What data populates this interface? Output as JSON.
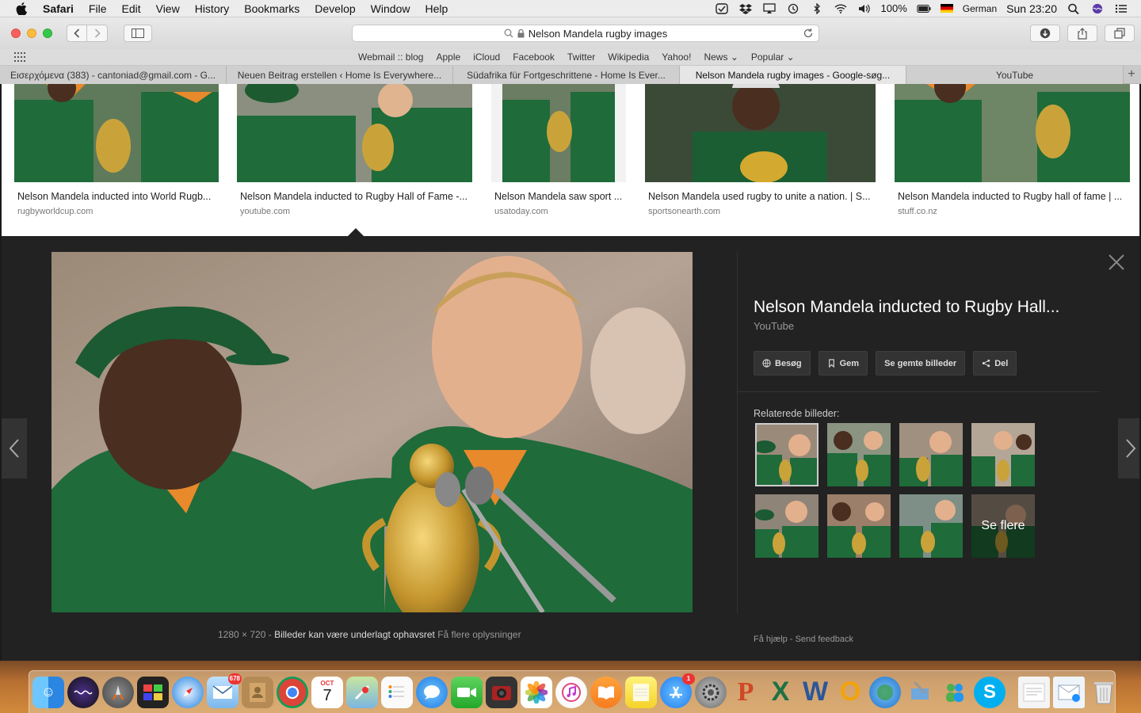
{
  "menubar": {
    "app_name": "Safari",
    "items": [
      "File",
      "Edit",
      "View",
      "History",
      "Bookmarks",
      "Develop",
      "Window",
      "Help"
    ],
    "battery": "100%",
    "input_source": "German",
    "clock": "Sun 23:20"
  },
  "toolbar": {
    "url": "Nelson Mandela rugby images"
  },
  "favorites": [
    "Webmail :: blog",
    "Apple",
    "iCloud",
    "Facebook",
    "Twitter",
    "Wikipedia",
    "Yahoo!",
    "News",
    "Popular"
  ],
  "tabs": [
    {
      "label": "Εισερχόμενα (383) - cantoniad@gmail.com - G...",
      "active": false
    },
    {
      "label": "Neuen Beitrag erstellen ‹ Home Is Everywhere...",
      "active": false
    },
    {
      "label": "Südafrika für Fortgeschrittene - Home Is Ever...",
      "active": false
    },
    {
      "label": "Nelson Mandela rugby images - Google-søg...",
      "active": true
    },
    {
      "label": "YouTube",
      "active": false
    }
  ],
  "results": [
    {
      "title": "Nelson Mandela inducted into World Rugb...",
      "source": "rugbyworldcup.com"
    },
    {
      "title": "Nelson Mandela inducted to Rugby Hall of Fame -...",
      "source": "youtube.com"
    },
    {
      "title": "Nelson Mandela saw sport ...",
      "source": "usatoday.com"
    },
    {
      "title": "Nelson Mandela used rugby to unite a nation. | S...",
      "source": "sportsonearth.com"
    },
    {
      "title": "Nelson Mandela inducted to Rugby hall of fame | ...",
      "source": "stuff.co.nz"
    }
  ],
  "viewer": {
    "title": "Nelson Mandela inducted to Rugby Hall...",
    "source": "YouTube",
    "actions": [
      "Besøg",
      "Gem",
      "Se gemte billeder",
      "Del"
    ],
    "related_label": "Relaterede billeder:",
    "see_more": "Se flere",
    "dimensions": "1280 × 720",
    "separator": "-",
    "copyright_notice": "Billeder kan være underlagt ophavsret",
    "more_info": "Få flere oplysninger",
    "help": "Få hjælp",
    "feedback": "Send feedback"
  },
  "dock": {
    "mail_badge": "678",
    "calendar_month": "OCT",
    "calendar_day": "7",
    "appstore_badge": "1"
  },
  "colors": {
    "green_jersey": "#1f6b3a",
    "orange_collar": "#e8892b",
    "viewer_bg": "#222222"
  }
}
